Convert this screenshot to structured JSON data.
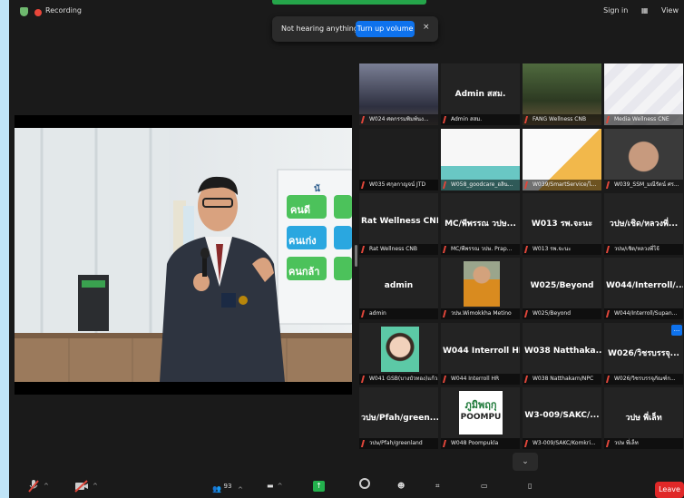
{
  "topbar": {
    "recording": "Recording",
    "sign_in": "Sign in",
    "view": "View"
  },
  "notification": {
    "text": "Not hearing anything?",
    "button": "Turn up volume",
    "close": "×"
  },
  "screen_text": {
    "blue": "นั",
    "green1": "คนดี",
    "blue1": "คนเก่ง",
    "green2": "คนกล้า"
  },
  "tiles": [
    {
      "big": "",
      "cap": "W024 ศตกรรมพิมพ์นง...",
      "type": "photo"
    },
    {
      "big": "Admin สสม.",
      "cap": "Admin สสม.",
      "type": "name"
    },
    {
      "big": "",
      "cap": "FANG Wellness CNB",
      "type": "photo"
    },
    {
      "big": "",
      "cap": "Media Wellness CNE",
      "type": "photo"
    },
    {
      "big": "",
      "cap": "W035 ศกุลกาญจน์ JTD",
      "type": "dark"
    },
    {
      "big": "",
      "cap": "W058_goodcare_อลิน...",
      "type": "slide"
    },
    {
      "big": "",
      "cap": "W039/SmartService/ไ...",
      "type": "slide"
    },
    {
      "big": "",
      "cap": "W039_SSM_มณีรัตน์ ศร...",
      "type": "person"
    },
    {
      "big": "Rat Wellness CNB",
      "cap": "Rat Wellness CNB",
      "type": "name"
    },
    {
      "big": "MC/พีพรรณ วปษ...",
      "cap": "MC/พีพรรณ วปษ. Prap...",
      "type": "name"
    },
    {
      "big": "W013 รพ.จะนะ",
      "cap": "W013 รพ.จะนะ",
      "type": "name"
    },
    {
      "big": "วปษ/เชิด/หลวงพี่...",
      "cap": "วปษ/เชิด/หลวงพี่โจ้",
      "type": "name"
    },
    {
      "big": "admin",
      "cap": "admin",
      "type": "name"
    },
    {
      "big": "",
      "cap": "วปษ.Wimokkha Metino",
      "type": "monk"
    },
    {
      "big": "W025/Beyond",
      "cap": "W025/Beyond",
      "type": "name"
    },
    {
      "big": "W044/Interroll/...",
      "cap": "W044/Interroll/Supan...",
      "type": "name"
    },
    {
      "big": "",
      "cap": "W041 GSB(บางบัวทอง)แก้ว...",
      "type": "avatar"
    },
    {
      "big": "W044 Interroll HR",
      "cap": "W044 Interroll HR",
      "type": "name"
    },
    {
      "big": "W038 Natthaka...",
      "cap": "W038 Natthakarn/NPC",
      "type": "name"
    },
    {
      "big": "W026/วิชรบรรจุ...",
      "cap": "W026/วิชรบรรจุภัณฑ์ก...",
      "type": "name"
    },
    {
      "big": "วปษ/Pfah/green...",
      "cap": "วปษ/Pfah/greenland",
      "type": "name"
    },
    {
      "big": "",
      "cap": "W048 Poompukla",
      "type": "logo",
      "logo_top": "ภูมิพฤกุ",
      "logo_bottom": "POOMPU"
    },
    {
      "big": "W3-009/SAKC/...",
      "cap": "W3-009/SAKC/Komkri...",
      "type": "name"
    },
    {
      "big": "วปษ พี่เล็ท",
      "cap": "วปษ พี่เล็ท",
      "type": "name"
    }
  ],
  "toolbar": {
    "participants_count": "93",
    "leave": "Leave",
    "more": "..."
  }
}
